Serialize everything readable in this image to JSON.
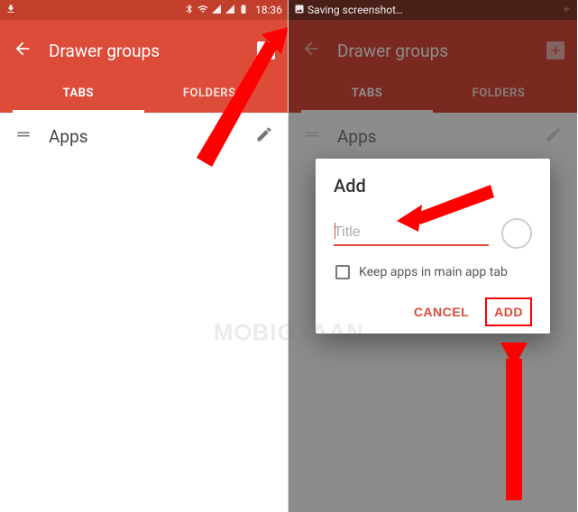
{
  "left": {
    "statusbar": {
      "time": "18:36"
    },
    "appbar": {
      "title": "Drawer groups"
    },
    "tabs": {
      "tab1": "TABS",
      "tab2": "FOLDERS"
    },
    "list": {
      "item0": "Apps"
    }
  },
  "right": {
    "statusbar": {
      "note": "Saving screenshot…"
    },
    "appbar": {
      "title": "Drawer groups"
    },
    "tabs": {
      "tab1": "TABS",
      "tab2": "FOLDERS"
    },
    "list": {
      "item0": "Apps"
    },
    "dialog": {
      "title": "Add",
      "input_placeholder": "Title",
      "checkbox_label": "Keep apps in main app tab",
      "cancel": "CANCEL",
      "add": "ADD"
    }
  },
  "watermark": "M   BIGYAAN"
}
